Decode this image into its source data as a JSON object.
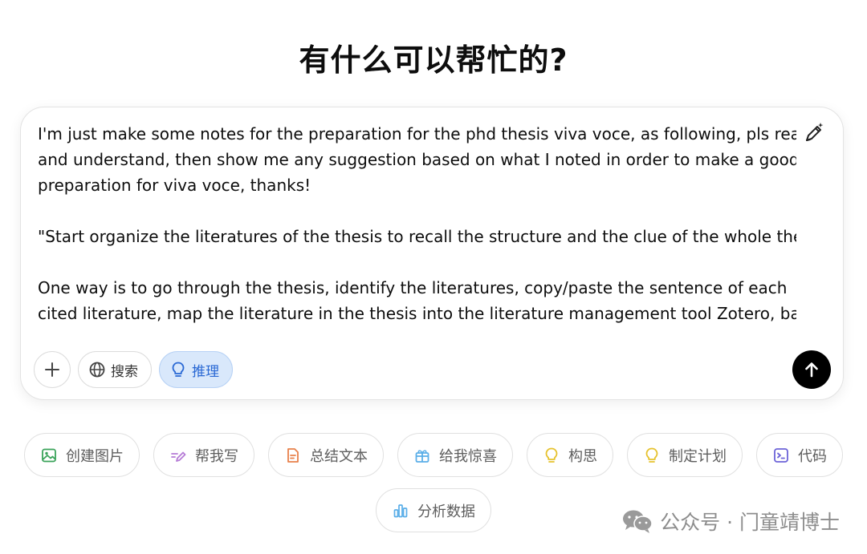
{
  "header": {
    "title": "有什么可以帮忙的?"
  },
  "composer": {
    "paragraphs": [
      [
        "I'm just make some notes for the preparation for the phd thesis viva voce, as following, pls read",
        "and understand, then show me any suggestion based on what I noted in order to make a good",
        "preparation for viva voce, thanks!"
      ],
      [
        "\"Start organize the literatures of the thesis to recall the structure and the clue of the whole thesis."
      ],
      [
        "One way is to go through the thesis, identify the literatures, copy/paste the sentence of each",
        "cited literature, map the literature in the thesis into the literature management tool Zotero, based"
      ]
    ],
    "tools": {
      "attach_icon": "plus-icon",
      "search_label": "搜索",
      "search_icon": "globe-icon",
      "reason_label": "推理",
      "reason_icon": "lightbulb-icon",
      "reason_active": true
    },
    "send_icon": "arrow-up-icon",
    "magic_icon": "magic-pen-icon"
  },
  "suggestions": [
    {
      "label": "创建图片",
      "icon": "image-icon",
      "color": "#3aa35a"
    },
    {
      "label": "帮我写",
      "icon": "pen-icon",
      "color": "#b57bd6"
    },
    {
      "label": "总结文本",
      "icon": "document-icon",
      "color": "#e8804a"
    },
    {
      "label": "给我惊喜",
      "icon": "gift-icon",
      "color": "#5aaee8"
    },
    {
      "label": "构思",
      "icon": "lightbulb-icon",
      "color": "#e6c22e"
    },
    {
      "label": "制定计划",
      "icon": "lightbulb-icon",
      "color": "#e6c22e"
    },
    {
      "label": "代码",
      "icon": "terminal-icon",
      "color": "#6c63d8"
    },
    {
      "label": "分析数据",
      "icon": "bar-chart-icon",
      "color": "#5aaee8"
    }
  ],
  "watermark": {
    "text": "公众号 · 门童靖博士",
    "icon": "wechat-icon"
  },
  "colors": {
    "active_pill_bg": "#d9e8fb",
    "active_pill_text": "#2968d4",
    "send_bg": "#000000"
  }
}
